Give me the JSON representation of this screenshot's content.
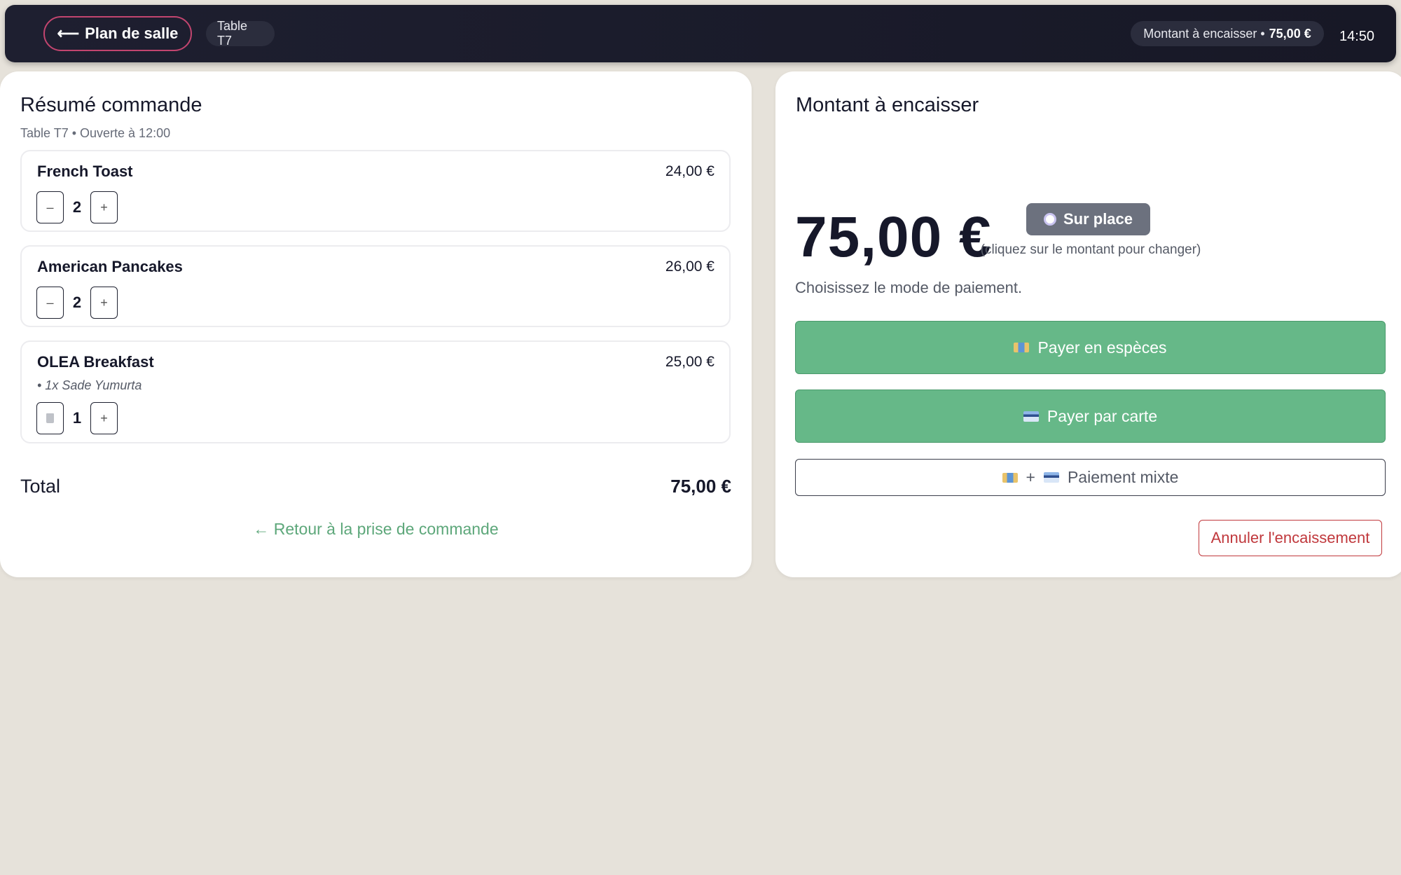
{
  "topbar": {
    "back_label": "Plan de salle",
    "table_chip": "Table T7",
    "amount_label": "Montant à encaisser •",
    "amount_value": "75,00 €",
    "time": "14:50"
  },
  "order": {
    "title": "Résumé commande",
    "subtitle": "Table T7 • Ouverte à 12:00",
    "items": [
      {
        "name": "French Toast",
        "price": "24,00 €",
        "qty": "2",
        "option": ""
      },
      {
        "name": "American Pancakes",
        "price": "26,00 €",
        "qty": "2",
        "option": ""
      },
      {
        "name": "OLEA Breakfast",
        "price": "25,00 €",
        "qty": "1",
        "option": "• 1x Sade Yumurta"
      }
    ],
    "minus_label": "–",
    "plus_label": "+",
    "total_label": "Total",
    "total_value": "75,00 €",
    "back_link": "← Retour à la prise de commande"
  },
  "payment": {
    "title": "Montant à encaisser",
    "amount": "75,00 €",
    "mode_label": "Sur place",
    "hint": "(cliquez sur le montant pour changer)",
    "choose_text": "Choisissez le mode de paiement.",
    "cash_label": "Payer en espèces",
    "card_label": "Payer par carte",
    "mixed_plus": "+",
    "mixed_label": "Paiement mixte",
    "cancel_label": "Annuler l'encaissement"
  },
  "icons": {
    "back": "arrow-left-icon",
    "plate": "plate-icon",
    "cash": "banknote-icon",
    "card": "credit-card-icon",
    "trash": "trash-icon"
  },
  "colors": {
    "topbar_bg": "#1e1f30",
    "accent_pink": "#c2456f",
    "pay_green": "#66b888",
    "cancel_red": "#c0383c",
    "link_green": "#5da77a",
    "page_bg": "#e6e2da"
  }
}
